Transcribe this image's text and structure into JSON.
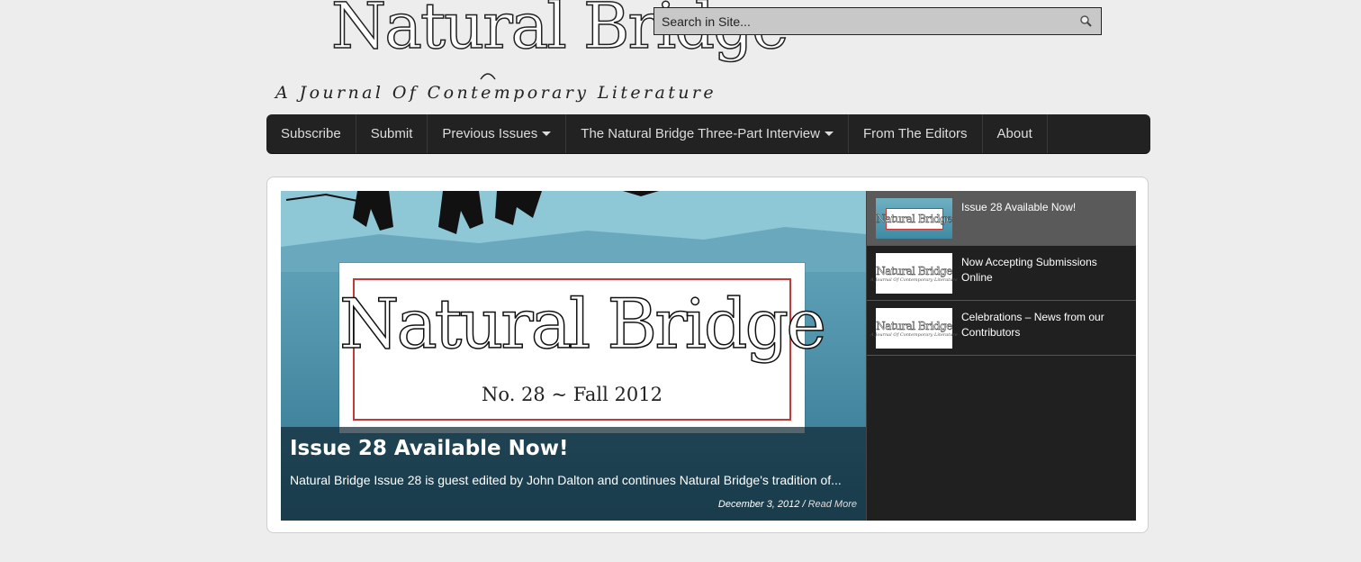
{
  "header": {
    "logo_title": "Natural Bridge",
    "logo_tagline": "A Journal Of Contemporary Literature"
  },
  "search": {
    "placeholder": "Search in Site...",
    "icon": "search-icon"
  },
  "nav": {
    "items": [
      {
        "label": "Subscribe",
        "has_dropdown": false
      },
      {
        "label": "Submit",
        "has_dropdown": false
      },
      {
        "label": "Previous Issues",
        "has_dropdown": true
      },
      {
        "label": "The Natural Bridge Three-Part Interview",
        "has_dropdown": true
      },
      {
        "label": "From The Editors",
        "has_dropdown": false
      },
      {
        "label": "About",
        "has_dropdown": false
      }
    ]
  },
  "featured": {
    "cover_title": "Natural Bridge",
    "cover_subtitle": "No. 28 ~ Fall 2012",
    "caption_title": "Issue 28 Available Now!",
    "caption_excerpt": "Natural Bridge Issue 28 is guest edited by John Dalton and continues Natural Bridge's tradition of...",
    "caption_date": "December 3, 2012 /",
    "caption_read_more": "Read More"
  },
  "sidebar_list": [
    {
      "label": "Issue 28 Available Now!",
      "active": true,
      "thumb_title": "Natural Bridge",
      "thumb_sub": ""
    },
    {
      "label": "Now Accepting Submissions Online",
      "active": false,
      "thumb_title": "Natural Bridge",
      "thumb_sub": "A Journal Of Contemporary Literature"
    },
    {
      "label": "Celebrations – News from our Contributors",
      "active": false,
      "thumb_title": "Natural Bridge",
      "thumb_sub": "A Journal Of Contemporary Literature"
    }
  ],
  "colors": {
    "page_bg": "#ededed",
    "nav_bg": "#222222",
    "cover_frame": "#c03a3a",
    "list_bg": "#202020",
    "list_active": "#5a5a5a"
  }
}
